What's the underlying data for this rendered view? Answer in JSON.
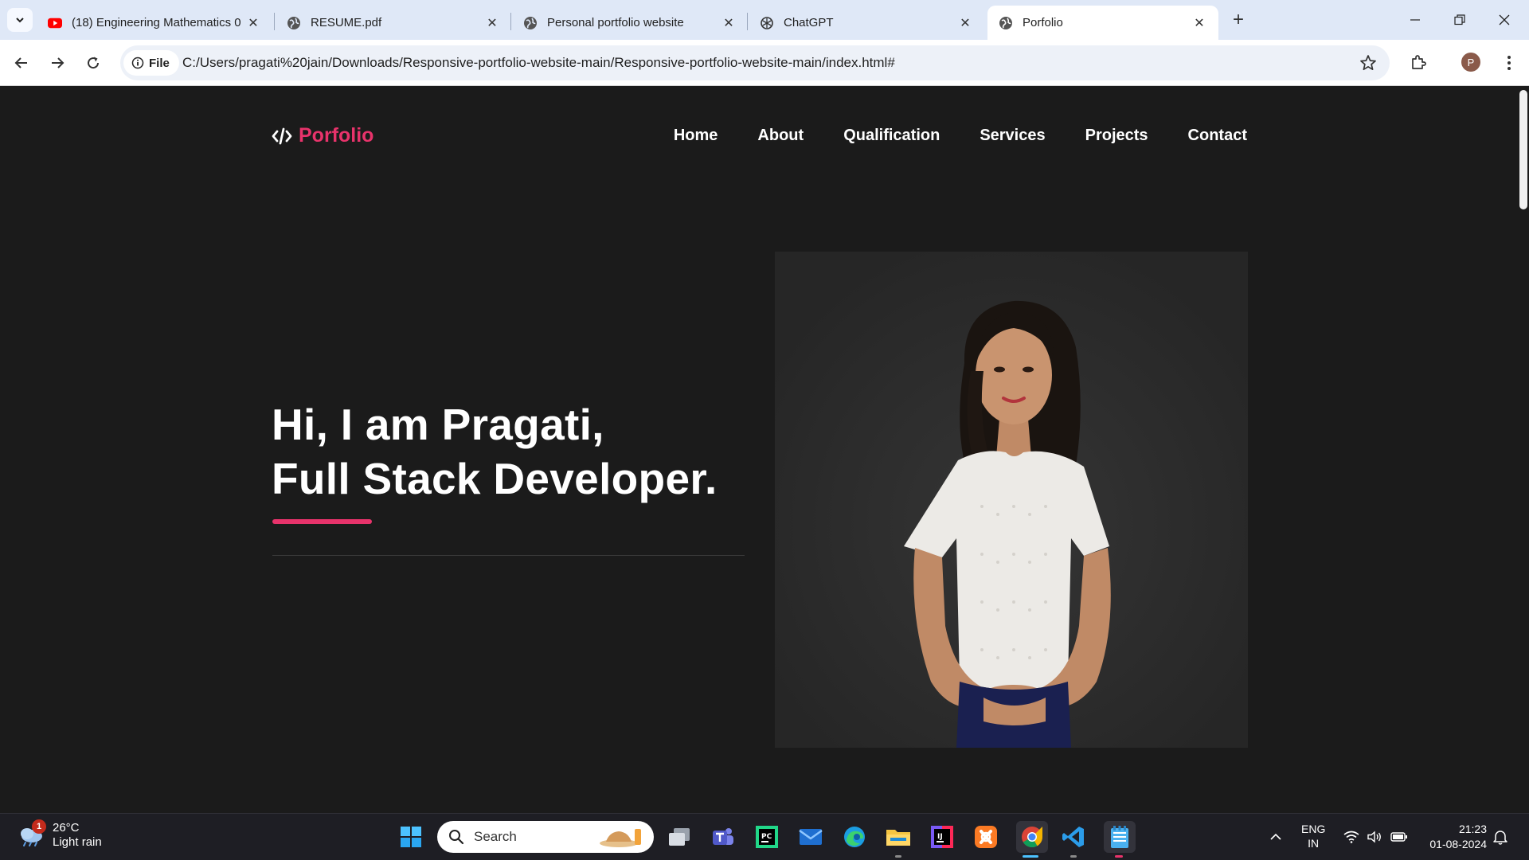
{
  "browser": {
    "tabs": [
      {
        "title": "(18) Engineering Mathematics 0",
        "favicon": "youtube-icon",
        "active": false
      },
      {
        "title": "RESUME.pdf",
        "favicon": "globe-icon",
        "active": false
      },
      {
        "title": "Personal portfolio website",
        "favicon": "globe-icon",
        "active": false
      },
      {
        "title": "ChatGPT",
        "favicon": "chatgpt-icon",
        "active": false
      },
      {
        "title": "Porfolio",
        "favicon": "globe-icon",
        "active": true
      }
    ],
    "site_chip": "File",
    "url": "C:/Users/pragati%20jain/Downloads/Responsive-portfolio-website-main/Responsive-portfolio-website-main/index.html#",
    "profile_initial": "P"
  },
  "site": {
    "logo_text": "Porfolio",
    "nav": [
      "Home",
      "About",
      "Qualification",
      "Services",
      "Projects",
      "Contact"
    ],
    "hero_line1": "Hi, I am Pragati,",
    "hero_line2": "Full Stack Developer.",
    "accent_color": "#e8336b",
    "background_color": "#1b1b1b"
  },
  "taskbar": {
    "weather_temp": "26°C",
    "weather_desc": "Light rain",
    "weather_badge": "1",
    "search_placeholder": "Search",
    "language_top": "ENG",
    "language_bottom": "IN",
    "time": "21:23",
    "date": "01-08-2024"
  }
}
